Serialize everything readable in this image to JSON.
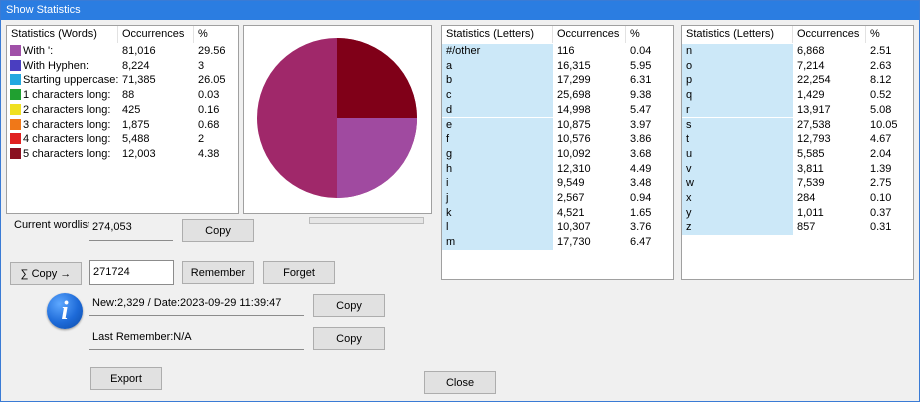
{
  "window": {
    "title": "Show Statistics"
  },
  "words_panel": {
    "headers": [
      "Statistics (Words)",
      "Occurrences",
      "%"
    ],
    "rows": [
      {
        "label": "With ':",
        "occ": "81,016",
        "pct": "29.56",
        "color": "#a050a8"
      },
      {
        "label": "With Hyphen:",
        "occ": "8,224",
        "pct": "3",
        "color": "#4a3ec0"
      },
      {
        "label": "Starting uppercase:",
        "occ": "71,385",
        "pct": "26.05",
        "color": "#22a8e0"
      },
      {
        "label": "1 characters long:",
        "occ": "88",
        "pct": "0.03",
        "color": "#20a030"
      },
      {
        "label": "2 characters long:",
        "occ": "425",
        "pct": "0.16",
        "color": "#f0e020"
      },
      {
        "label": "3 characters long:",
        "occ": "1,875",
        "pct": "0.68",
        "color": "#f07818"
      },
      {
        "label": "4 characters long:",
        "occ": "5,488",
        "pct": "2",
        "color": "#e02020"
      },
      {
        "label": "5 characters long:",
        "occ": "12,003",
        "pct": "4.38",
        "color": "#8a1020"
      }
    ]
  },
  "pie": {
    "color_main": "#a0286a",
    "color_top": "#800018",
    "color_slice": "#a04aa0",
    "progress_fraction": 0
  },
  "letters_left": {
    "headers": [
      "Statistics (Letters)",
      "Occurrences",
      "%"
    ],
    "rows": [
      {
        "label": "#/other",
        "occ": "116",
        "pct": "0.04"
      },
      {
        "label": "a",
        "occ": "16,315",
        "pct": "5.95"
      },
      {
        "label": "b",
        "occ": "17,299",
        "pct": "6.31"
      },
      {
        "label": "c",
        "occ": "25,698",
        "pct": "9.38"
      },
      {
        "label": "d",
        "occ": "14,998",
        "pct": "5.47"
      },
      {
        "label": "e",
        "occ": "10,875",
        "pct": "3.97"
      },
      {
        "label": "f",
        "occ": "10,576",
        "pct": "3.86"
      },
      {
        "label": "g",
        "occ": "10,092",
        "pct": "3.68"
      },
      {
        "label": "h",
        "occ": "12,310",
        "pct": "4.49"
      },
      {
        "label": "i",
        "occ": "9,549",
        "pct": "3.48"
      },
      {
        "label": "j",
        "occ": "2,567",
        "pct": "0.94"
      },
      {
        "label": "k",
        "occ": "4,521",
        "pct": "1.65"
      },
      {
        "label": "l",
        "occ": "10,307",
        "pct": "3.76"
      },
      {
        "label": "m",
        "occ": "17,730",
        "pct": "6.47"
      }
    ]
  },
  "letters_right": {
    "headers": [
      "Statistics (Letters)",
      "Occurrences",
      "%"
    ],
    "rows": [
      {
        "label": "n",
        "occ": "6,868",
        "pct": "2.51"
      },
      {
        "label": "o",
        "occ": "7,214",
        "pct": "2.63"
      },
      {
        "label": "p",
        "occ": "22,254",
        "pct": "8.12"
      },
      {
        "label": "q",
        "occ": "1,429",
        "pct": "0.52"
      },
      {
        "label": "r",
        "occ": "13,917",
        "pct": "5.08"
      },
      {
        "label": "s",
        "occ": "27,538",
        "pct": "10.05"
      },
      {
        "label": "t",
        "occ": "12,793",
        "pct": "4.67"
      },
      {
        "label": "u",
        "occ": "5,585",
        "pct": "2.04"
      },
      {
        "label": "v",
        "occ": "3,811",
        "pct": "1.39"
      },
      {
        "label": "w",
        "occ": "7,539",
        "pct": "2.75"
      },
      {
        "label": "x",
        "occ": "284",
        "pct": "0.10"
      },
      {
        "label": "y",
        "occ": "1,011",
        "pct": "0.37"
      },
      {
        "label": "z",
        "occ": "857",
        "pct": "0.31"
      }
    ]
  },
  "controls": {
    "current_wordlist_label": "Current wordlist:",
    "current_wordlist_value": "274,053",
    "copy_label": "Copy",
    "sum_copy_label": "∑ Copy →",
    "remember_input": "271724",
    "remember_label": "Remember",
    "forget_label": "Forget",
    "new_info": "New:2,329 / Date:2023-09-29 11:39:47",
    "last_remember": "Last Remember:N/A",
    "export_label": "Export",
    "close_label": "Close",
    "info_icon_glyph": "i"
  }
}
